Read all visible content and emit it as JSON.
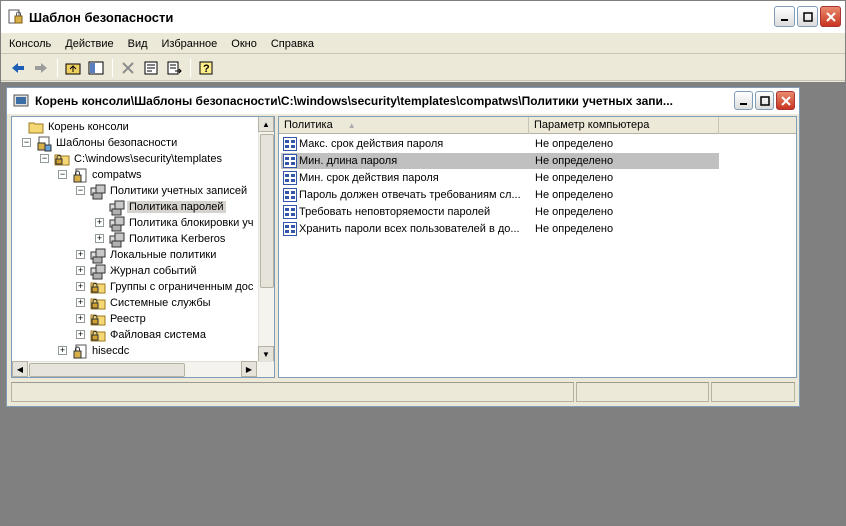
{
  "app": {
    "title": "Шаблон безопасности",
    "menu": [
      "Консоль",
      "Действие",
      "Вид",
      "Избранное",
      "Окно",
      "Справка"
    ]
  },
  "mdi": {
    "title": "Корень консоли\\Шаблоны безопасности\\C:\\windows\\security\\templates\\compatws\\Политики учетных запи..."
  },
  "tree": [
    {
      "label": "Корень консоли",
      "level": 0,
      "icon": "folder-icon",
      "expander": ""
    },
    {
      "label": "Шаблоны безопасности",
      "level": 1,
      "icon": "security-templates-icon",
      "expander": "-"
    },
    {
      "label": "C:\\windows\\security\\templates",
      "level": 2,
      "icon": "folder-lock-icon",
      "expander": "-"
    },
    {
      "label": "compatws",
      "level": 3,
      "icon": "template-icon",
      "expander": "-"
    },
    {
      "label": "Политики учетных записей",
      "level": 4,
      "icon": "policy-icon",
      "expander": "-"
    },
    {
      "label": "Политика паролей",
      "level": 5,
      "icon": "policy-icon",
      "expander": "",
      "selected": true
    },
    {
      "label": "Политика блокировки уч",
      "level": 5,
      "icon": "policy-icon",
      "expander": "+"
    },
    {
      "label": "Политика Kerberos",
      "level": 5,
      "icon": "policy-icon",
      "expander": "+"
    },
    {
      "label": "Локальные политики",
      "level": 4,
      "icon": "policy-icon",
      "expander": "+"
    },
    {
      "label": "Журнал событий",
      "level": 4,
      "icon": "policy-icon",
      "expander": "+"
    },
    {
      "label": "Группы с ограниченным дос",
      "level": 4,
      "icon": "folder-lock-icon",
      "expander": "+"
    },
    {
      "label": "Системные службы",
      "level": 4,
      "icon": "folder-lock-icon",
      "expander": "+"
    },
    {
      "label": "Реестр",
      "level": 4,
      "icon": "folder-lock-icon",
      "expander": "+"
    },
    {
      "label": "Файловая система",
      "level": 4,
      "icon": "folder-lock-icon",
      "expander": "+"
    },
    {
      "label": "hisecdc",
      "level": 3,
      "icon": "template-icon",
      "expander": "+"
    }
  ],
  "list": {
    "columns": [
      "Политика",
      "Параметр компьютера"
    ],
    "rows": [
      {
        "policy": "Макс. срок действия пароля",
        "value": "Не определено"
      },
      {
        "policy": "Мин. длина пароля",
        "value": "Не определено",
        "selected": true
      },
      {
        "policy": "Мин. срок действия пароля",
        "value": "Не определено"
      },
      {
        "policy": "Пароль должен отвечать требованиям сл...",
        "value": "Не определено"
      },
      {
        "policy": "Требовать неповторяемости паролей",
        "value": "Не определено"
      },
      {
        "policy": "Хранить пароли всех пользователей в до...",
        "value": "Не определено"
      }
    ]
  },
  "colors": {
    "workspace": "#808080",
    "face": "#ece9d8",
    "selected_row": "#c0c0c0"
  }
}
